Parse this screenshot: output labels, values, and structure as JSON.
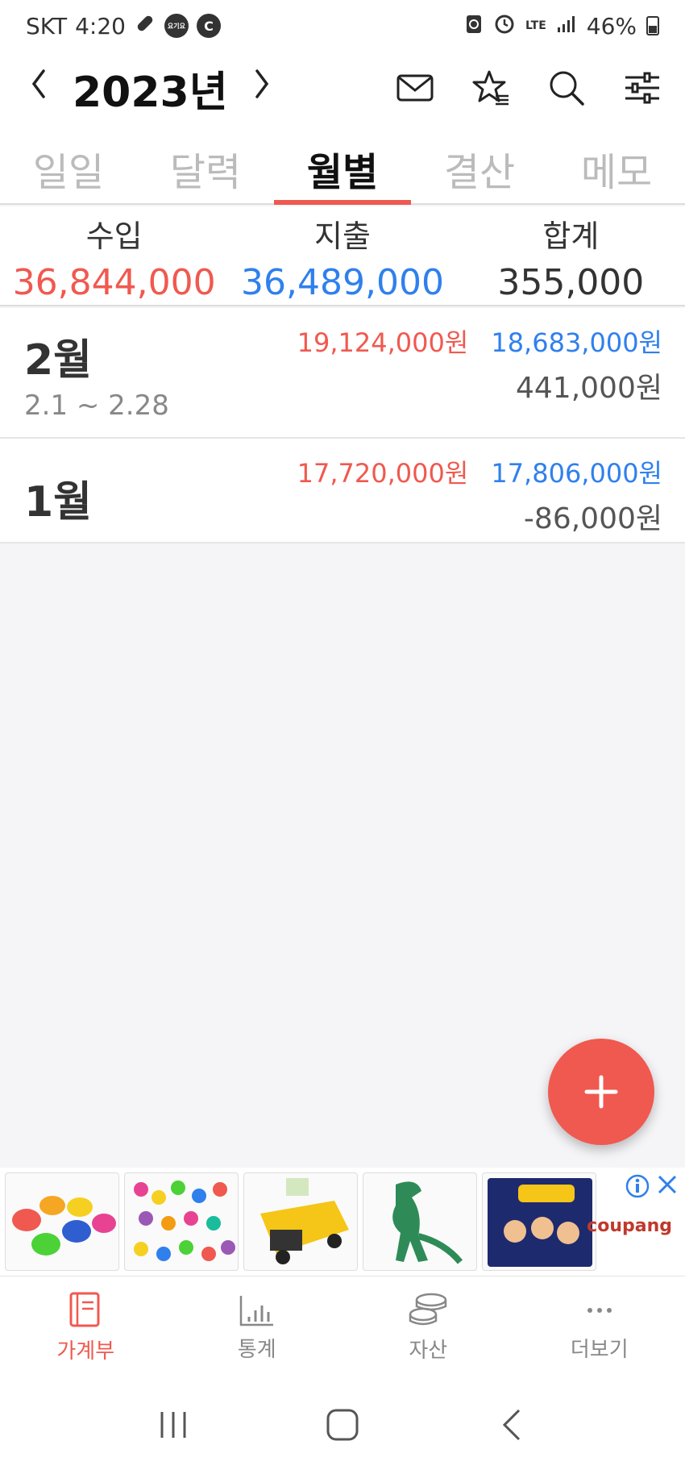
{
  "status_bar": {
    "carrier": "SKT",
    "time": "4:20",
    "network": "LTE",
    "battery": "46%",
    "badge_c": "C",
    "badge_small": "요기요"
  },
  "header": {
    "year": "2023년",
    "prev_icon": "chevron-left-icon",
    "next_icon": "chevron-right-icon"
  },
  "tabs": [
    {
      "label": "일일",
      "active": false
    },
    {
      "label": "달력",
      "active": false
    },
    {
      "label": "월별",
      "active": true
    },
    {
      "label": "결산",
      "active": false
    },
    {
      "label": "메모",
      "active": false
    }
  ],
  "summary": {
    "income_label": "수입",
    "income_value": "36,844,000",
    "expense_label": "지출",
    "expense_value": "36,489,000",
    "total_label": "합계",
    "total_value": "355,000"
  },
  "months": [
    {
      "name": "2월",
      "range": "2.1 ~ 2.28",
      "income": "19,124,000원",
      "expense": "18,683,000원",
      "total": "441,000원"
    },
    {
      "name": "1월",
      "range": "",
      "income": "17,720,000원",
      "expense": "17,806,000원",
      "total": "-86,000원"
    }
  ],
  "ad": {
    "brand": "coupang",
    "info_icon": "info-icon",
    "close_icon": "close-icon"
  },
  "bottom_nav": [
    {
      "label": "가계부",
      "icon": "book-icon",
      "active": true
    },
    {
      "label": "통계",
      "icon": "bar-chart-icon",
      "active": false
    },
    {
      "label": "자산",
      "icon": "coins-icon",
      "active": false
    },
    {
      "label": "더보기",
      "icon": "more-icon",
      "active": false
    }
  ],
  "colors": {
    "accent": "#f0594f",
    "income": "#f0594f",
    "expense": "#2f80ed",
    "text": "#333333"
  }
}
